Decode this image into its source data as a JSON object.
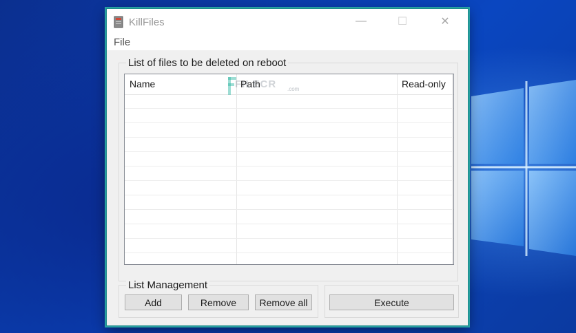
{
  "window": {
    "title": "KillFiles",
    "menu": {
      "file": "File"
    },
    "controls": {
      "minimize": "—",
      "maximize": "☐",
      "close": "✕"
    }
  },
  "files_group": {
    "title": "List of files to be deleted on reboot",
    "columns": [
      "Name",
      "Path",
      "Read-only"
    ],
    "rows": []
  },
  "management_group": {
    "title": "List Management",
    "add": "Add",
    "remove": "Remove",
    "remove_all": "Remove all"
  },
  "execute_group": {
    "execute": "Execute"
  },
  "watermark": {
    "text": "FILECR",
    "suffix": ".com"
  },
  "colors": {
    "accent_border": "#27a0a0",
    "desktop": "#0a46c0"
  }
}
